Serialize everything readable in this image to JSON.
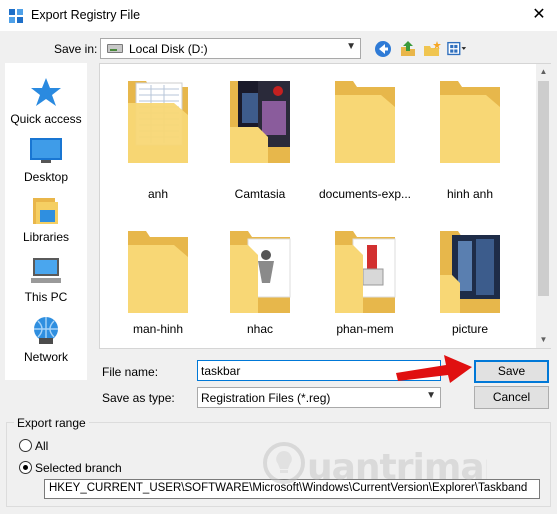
{
  "window": {
    "title": "Export Registry File",
    "close_symbol": "✕"
  },
  "save_in": {
    "label": "Save in:",
    "value": "Local Disk (D:)"
  },
  "places": [
    {
      "name": "quick-access",
      "label": "Quick access",
      "icon": "star-icon"
    },
    {
      "name": "desktop",
      "label": "Desktop",
      "icon": "desktop-icon"
    },
    {
      "name": "libraries",
      "label": "Libraries",
      "icon": "libraries-icon"
    },
    {
      "name": "this-pc",
      "label": "This PC",
      "icon": "computer-icon"
    },
    {
      "name": "network",
      "label": "Network",
      "icon": "network-icon"
    }
  ],
  "folders": [
    {
      "label": "anh",
      "preview": "table"
    },
    {
      "label": "Camtasia",
      "preview": "photo"
    },
    {
      "label": "documents-exp...",
      "preview": "none"
    },
    {
      "label": "hinh anh",
      "preview": "none"
    },
    {
      "label": "man-hinh",
      "preview": "none"
    },
    {
      "label": "nhac",
      "preview": "sketch"
    },
    {
      "label": "phan-mem",
      "preview": "installer"
    },
    {
      "label": "picture",
      "preview": "photo2"
    }
  ],
  "file_name": {
    "label": "File name:",
    "value": "taskbar"
  },
  "save_as_type": {
    "label": "Save as type:",
    "value": "Registration Files (*.reg)"
  },
  "buttons": {
    "save": "Save",
    "cancel": "Cancel"
  },
  "export_range": {
    "title": "Export range",
    "all_label": "All",
    "selected_label": "Selected branch",
    "selected": "branch",
    "branch_path": "HKEY_CURRENT_USER\\SOFTWARE\\Microsoft\\Windows\\CurrentVersion\\Explorer\\Taskband"
  },
  "watermark": "uantrimang",
  "colors": {
    "accent": "#0078d7",
    "folder": "#f8d775",
    "arrow": "#e01010"
  }
}
